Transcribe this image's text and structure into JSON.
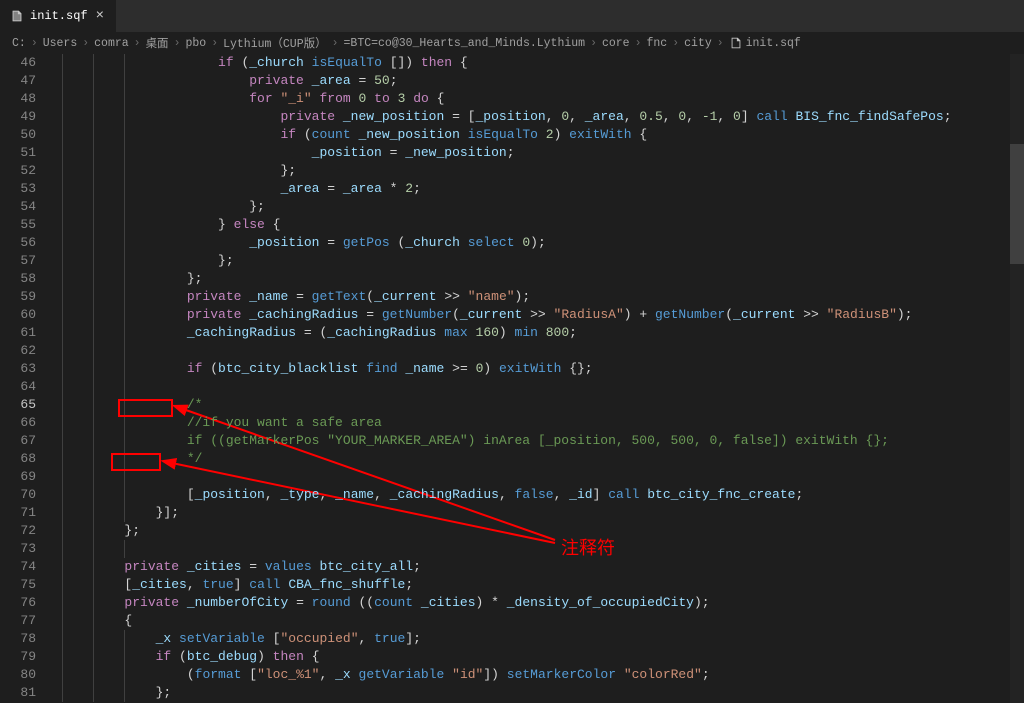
{
  "tab": {
    "filename": "init.sqf"
  },
  "breadcrumb": {
    "parts": [
      "C:",
      "Users",
      "comra",
      "桌面",
      "pbo",
      "Lythium（CUP版）",
      "=BTC=co@30_Hearts_and_Minds.Lythium",
      "core",
      "fnc",
      "city"
    ],
    "file": "init.sqf"
  },
  "annotation_label": "注释符",
  "lines": [
    {
      "n": 46,
      "indent": 5,
      "seg": [
        [
          "kw",
          "if"
        ],
        [
          "op",
          " ("
        ],
        [
          "var",
          "_church"
        ],
        [
          "op",
          " "
        ],
        [
          "fn",
          "isEqualTo"
        ],
        [
          "op",
          " []) "
        ],
        [
          "kw",
          "then"
        ],
        [
          "op",
          " {"
        ]
      ]
    },
    {
      "n": 47,
      "indent": 6,
      "seg": [
        [
          "kw",
          "private"
        ],
        [
          "op",
          " "
        ],
        [
          "var",
          "_area"
        ],
        [
          "op",
          " = "
        ],
        [
          "num",
          "50"
        ],
        [
          "op",
          ";"
        ]
      ]
    },
    {
      "n": 48,
      "indent": 6,
      "seg": [
        [
          "kw",
          "for"
        ],
        [
          "op",
          " "
        ],
        [
          "str",
          "\"_i\""
        ],
        [
          "op",
          " "
        ],
        [
          "kw",
          "from"
        ],
        [
          "op",
          " "
        ],
        [
          "num",
          "0"
        ],
        [
          "op",
          " "
        ],
        [
          "kw",
          "to"
        ],
        [
          "op",
          " "
        ],
        [
          "num",
          "3"
        ],
        [
          "op",
          " "
        ],
        [
          "kw",
          "do"
        ],
        [
          "op",
          " {"
        ]
      ]
    },
    {
      "n": 49,
      "indent": 7,
      "seg": [
        [
          "kw",
          "private"
        ],
        [
          "op",
          " "
        ],
        [
          "var",
          "_new_position"
        ],
        [
          "op",
          " = ["
        ],
        [
          "var",
          "_position"
        ],
        [
          "op",
          ", "
        ],
        [
          "num",
          "0"
        ],
        [
          "op",
          ", "
        ],
        [
          "var",
          "_area"
        ],
        [
          "op",
          ", "
        ],
        [
          "num",
          "0.5"
        ],
        [
          "op",
          ", "
        ],
        [
          "num",
          "0"
        ],
        [
          "op",
          ", "
        ],
        [
          "num",
          "-1"
        ],
        [
          "op",
          ", "
        ],
        [
          "num",
          "0"
        ],
        [
          "op",
          "] "
        ],
        [
          "fn",
          "call"
        ],
        [
          "op",
          " "
        ],
        [
          "var",
          "BIS_fnc_findSafePos"
        ],
        [
          "op",
          ";"
        ]
      ]
    },
    {
      "n": 50,
      "indent": 7,
      "seg": [
        [
          "kw",
          "if"
        ],
        [
          "op",
          " ("
        ],
        [
          "fn",
          "count"
        ],
        [
          "op",
          " "
        ],
        [
          "var",
          "_new_position"
        ],
        [
          "op",
          " "
        ],
        [
          "fn",
          "isEqualTo"
        ],
        [
          "op",
          " "
        ],
        [
          "num",
          "2"
        ],
        [
          "op",
          ") "
        ],
        [
          "fn",
          "exitWith"
        ],
        [
          "op",
          " {"
        ]
      ]
    },
    {
      "n": 51,
      "indent": 8,
      "seg": [
        [
          "var",
          "_position"
        ],
        [
          "op",
          " = "
        ],
        [
          "var",
          "_new_position"
        ],
        [
          "op",
          ";"
        ]
      ]
    },
    {
      "n": 52,
      "indent": 7,
      "seg": [
        [
          "op",
          "};"
        ]
      ]
    },
    {
      "n": 53,
      "indent": 7,
      "seg": [
        [
          "var",
          "_area"
        ],
        [
          "op",
          " = "
        ],
        [
          "var",
          "_area"
        ],
        [
          "op",
          " * "
        ],
        [
          "num",
          "2"
        ],
        [
          "op",
          ";"
        ]
      ]
    },
    {
      "n": 54,
      "indent": 6,
      "seg": [
        [
          "op",
          "};"
        ]
      ]
    },
    {
      "n": 55,
      "indent": 5,
      "seg": [
        [
          "op",
          "} "
        ],
        [
          "kw",
          "else"
        ],
        [
          "op",
          " {"
        ]
      ]
    },
    {
      "n": 56,
      "indent": 6,
      "seg": [
        [
          "var",
          "_position"
        ],
        [
          "op",
          " = "
        ],
        [
          "fn",
          "getPos"
        ],
        [
          "op",
          " ("
        ],
        [
          "var",
          "_church"
        ],
        [
          "op",
          " "
        ],
        [
          "fn",
          "select"
        ],
        [
          "op",
          " "
        ],
        [
          "num",
          "0"
        ],
        [
          "op",
          ");"
        ]
      ]
    },
    {
      "n": 57,
      "indent": 5,
      "seg": [
        [
          "op",
          "};"
        ]
      ]
    },
    {
      "n": 58,
      "indent": 4,
      "seg": [
        [
          "op",
          "};"
        ]
      ]
    },
    {
      "n": 59,
      "indent": 4,
      "seg": [
        [
          "kw",
          "private"
        ],
        [
          "op",
          " "
        ],
        [
          "var",
          "_name"
        ],
        [
          "op",
          " = "
        ],
        [
          "fn",
          "getText"
        ],
        [
          "op",
          "("
        ],
        [
          "var",
          "_current"
        ],
        [
          "op",
          " >> "
        ],
        [
          "str",
          "\"name\""
        ],
        [
          "op",
          ");"
        ]
      ]
    },
    {
      "n": 60,
      "indent": 4,
      "seg": [
        [
          "kw",
          "private"
        ],
        [
          "op",
          " "
        ],
        [
          "var",
          "_cachingRadius"
        ],
        [
          "op",
          " = "
        ],
        [
          "fn",
          "getNumber"
        ],
        [
          "op",
          "("
        ],
        [
          "var",
          "_current"
        ],
        [
          "op",
          " >> "
        ],
        [
          "str",
          "\"RadiusA\""
        ],
        [
          "op",
          ") + "
        ],
        [
          "fn",
          "getNumber"
        ],
        [
          "op",
          "("
        ],
        [
          "var",
          "_current"
        ],
        [
          "op",
          " >> "
        ],
        [
          "str",
          "\"RadiusB\""
        ],
        [
          "op",
          ");"
        ]
      ]
    },
    {
      "n": 61,
      "indent": 4,
      "seg": [
        [
          "var",
          "_cachingRadius"
        ],
        [
          "op",
          " = ("
        ],
        [
          "var",
          "_cachingRadius"
        ],
        [
          "op",
          " "
        ],
        [
          "fn",
          "max"
        ],
        [
          "op",
          " "
        ],
        [
          "num",
          "160"
        ],
        [
          "op",
          ") "
        ],
        [
          "fn",
          "min"
        ],
        [
          "op",
          " "
        ],
        [
          "num",
          "800"
        ],
        [
          "op",
          ";"
        ]
      ]
    },
    {
      "n": 62,
      "indent": 0,
      "seg": []
    },
    {
      "n": 63,
      "indent": 4,
      "seg": [
        [
          "kw",
          "if"
        ],
        [
          "op",
          " ("
        ],
        [
          "var",
          "btc_city_blacklist"
        ],
        [
          "op",
          " "
        ],
        [
          "fn",
          "find"
        ],
        [
          "op",
          " "
        ],
        [
          "var",
          "_name"
        ],
        [
          "op",
          " >= "
        ],
        [
          "num",
          "0"
        ],
        [
          "op",
          ") "
        ],
        [
          "fn",
          "exitWith"
        ],
        [
          "op",
          " {};"
        ]
      ]
    },
    {
      "n": 64,
      "indent": 0,
      "seg": []
    },
    {
      "n": 65,
      "indent": 4,
      "seg": [
        [
          "cmt",
          "/*"
        ]
      ],
      "active": true
    },
    {
      "n": 66,
      "indent": 4,
      "seg": [
        [
          "cmt",
          "//if you want a safe area"
        ]
      ]
    },
    {
      "n": 67,
      "indent": 4,
      "seg": [
        [
          "cmt",
          "if ((getMarkerPos \"YOUR_MARKER_AREA\") inArea [_position, 500, 500, 0, false]) exitWith {};"
        ]
      ]
    },
    {
      "n": 68,
      "indent": 4,
      "seg": [
        [
          "cmt",
          "*/"
        ]
      ]
    },
    {
      "n": 69,
      "indent": 0,
      "seg": []
    },
    {
      "n": 70,
      "indent": 4,
      "seg": [
        [
          "op",
          "["
        ],
        [
          "var",
          "_position"
        ],
        [
          "op",
          ", "
        ],
        [
          "var",
          "_type"
        ],
        [
          "op",
          ", "
        ],
        [
          "var",
          "_name"
        ],
        [
          "op",
          ", "
        ],
        [
          "var",
          "_cachingRadius"
        ],
        [
          "op",
          ", "
        ],
        [
          "const",
          "false"
        ],
        [
          "op",
          ", "
        ],
        [
          "var",
          "_id"
        ],
        [
          "op",
          "] "
        ],
        [
          "fn",
          "call"
        ],
        [
          "op",
          " "
        ],
        [
          "var",
          "btc_city_fnc_create"
        ],
        [
          "op",
          ";"
        ]
      ]
    },
    {
      "n": 71,
      "indent": 3,
      "seg": [
        [
          "op",
          "}];"
        ]
      ]
    },
    {
      "n": 72,
      "indent": 2,
      "seg": [
        [
          "op",
          "};"
        ]
      ]
    },
    {
      "n": 73,
      "indent": 0,
      "seg": []
    },
    {
      "n": 74,
      "indent": 2,
      "seg": [
        [
          "kw",
          "private"
        ],
        [
          "op",
          " "
        ],
        [
          "var",
          "_cities"
        ],
        [
          "op",
          " = "
        ],
        [
          "fn",
          "values"
        ],
        [
          "op",
          " "
        ],
        [
          "var",
          "btc_city_all"
        ],
        [
          "op",
          ";"
        ]
      ]
    },
    {
      "n": 75,
      "indent": 2,
      "seg": [
        [
          "op",
          "["
        ],
        [
          "var",
          "_cities"
        ],
        [
          "op",
          ", "
        ],
        [
          "const",
          "true"
        ],
        [
          "op",
          "] "
        ],
        [
          "fn",
          "call"
        ],
        [
          "op",
          " "
        ],
        [
          "var",
          "CBA_fnc_shuffle"
        ],
        [
          "op",
          ";"
        ]
      ]
    },
    {
      "n": 76,
      "indent": 2,
      "seg": [
        [
          "kw",
          "private"
        ],
        [
          "op",
          " "
        ],
        [
          "var",
          "_numberOfCity"
        ],
        [
          "op",
          " = "
        ],
        [
          "fn",
          "round"
        ],
        [
          "op",
          " (("
        ],
        [
          "fn",
          "count"
        ],
        [
          "op",
          " "
        ],
        [
          "var",
          "_cities"
        ],
        [
          "op",
          ") * "
        ],
        [
          "var",
          "_density_of_occupiedCity"
        ],
        [
          "op",
          ");"
        ]
      ]
    },
    {
      "n": 77,
      "indent": 2,
      "seg": [
        [
          "op",
          "{"
        ]
      ]
    },
    {
      "n": 78,
      "indent": 3,
      "seg": [
        [
          "var",
          "_x"
        ],
        [
          "op",
          " "
        ],
        [
          "fn",
          "setVariable"
        ],
        [
          "op",
          " ["
        ],
        [
          "str",
          "\"occupied\""
        ],
        [
          "op",
          ", "
        ],
        [
          "const",
          "true"
        ],
        [
          "op",
          "];"
        ]
      ]
    },
    {
      "n": 79,
      "indent": 3,
      "seg": [
        [
          "kw",
          "if"
        ],
        [
          "op",
          " ("
        ],
        [
          "var",
          "btc_debug"
        ],
        [
          "op",
          ") "
        ],
        [
          "kw",
          "then"
        ],
        [
          "op",
          " {"
        ]
      ]
    },
    {
      "n": 80,
      "indent": 4,
      "seg": [
        [
          "op",
          "("
        ],
        [
          "fn",
          "format"
        ],
        [
          "op",
          " ["
        ],
        [
          "str",
          "\"loc_%1\""
        ],
        [
          "op",
          ", "
        ],
        [
          "var",
          "_x"
        ],
        [
          "op",
          " "
        ],
        [
          "fn",
          "getVariable"
        ],
        [
          "op",
          " "
        ],
        [
          "str",
          "\"id\""
        ],
        [
          "op",
          "]) "
        ],
        [
          "fn",
          "setMarkerColor"
        ],
        [
          "op",
          " "
        ],
        [
          "str",
          "\"colorRed\""
        ],
        [
          "op",
          ";"
        ]
      ]
    },
    {
      "n": 81,
      "indent": 3,
      "seg": [
        [
          "op",
          "};"
        ]
      ]
    }
  ]
}
